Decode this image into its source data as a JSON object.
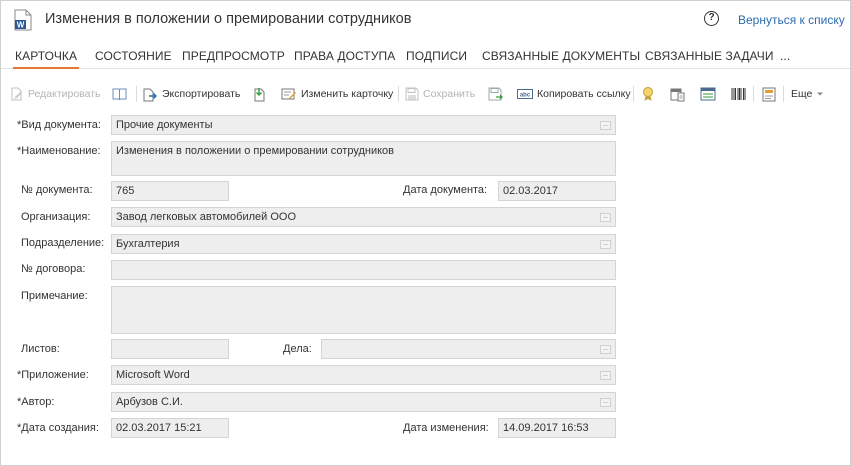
{
  "header": {
    "title": "Изменения в положении о премировании сотрудников",
    "doc_icon_letter": "W",
    "back_link": "Вернуться к списку",
    "help_glyph": "?"
  },
  "tabs": [
    {
      "label": "КАРТОЧКА",
      "active": true
    },
    {
      "label": "СОСТОЯНИЕ"
    },
    {
      "label": "ПРЕДПРОСМОТР"
    },
    {
      "label": "ПРАВА ДОСТУПА"
    },
    {
      "label": "ПОДПИСИ"
    },
    {
      "label": "СВЯЗАННЫЕ ДОКУМЕНТЫ"
    },
    {
      "label": "СВЯЗАННЫЕ ЗАДАЧИ"
    },
    {
      "label": "..."
    }
  ],
  "toolbar": {
    "edit": "Редактировать",
    "export": "Экспортировать",
    "edit_card": "Изменить карточку",
    "save": "Сохранить",
    "copy_link": "Копировать ссылку",
    "more": "Еще",
    "icons": [
      "pencil-icon",
      "book-icon",
      "export-icon",
      "import-icon",
      "edit-card-icon",
      "save-icon",
      "save-as-icon",
      "link-icon",
      "award-icon",
      "calendar-icon",
      "list-icon",
      "barcode-icon",
      "note-icon"
    ]
  },
  "form": {
    "doc_type": {
      "label": "*Вид документа:",
      "value": "Прочие документы"
    },
    "name": {
      "label": "*Наименование:",
      "value": "Изменения в положении о премировании сотрудников"
    },
    "doc_number": {
      "label": "№ документа:",
      "value": "765"
    },
    "doc_date": {
      "label": "Дата документа:",
      "value": "02.03.2017"
    },
    "organization": {
      "label": "Организация:",
      "value": "Завод легковых автомобилей ООО"
    },
    "department": {
      "label": "Подразделение:",
      "value": "Бухгалтерия"
    },
    "contract": {
      "label": "№ договора:",
      "value": ""
    },
    "note": {
      "label": "Примечание:",
      "value": ""
    },
    "sheets": {
      "label": "Листов:",
      "value": ""
    },
    "cases": {
      "label": "Дела:",
      "value": ""
    },
    "application": {
      "label": "*Приложение:",
      "value": "Microsoft Word"
    },
    "author": {
      "label": "*Автор:",
      "value": "Арбузов С.И."
    },
    "created": {
      "label": "*Дата создания:",
      "value": "02.03.2017 15:21"
    },
    "modified": {
      "label": "Дата изменения:",
      "value": "14.09.2017 16:53"
    }
  },
  "colors": {
    "accent": "#e07a35",
    "link": "#2b6bb0",
    "word_blue": "#2b5797"
  }
}
